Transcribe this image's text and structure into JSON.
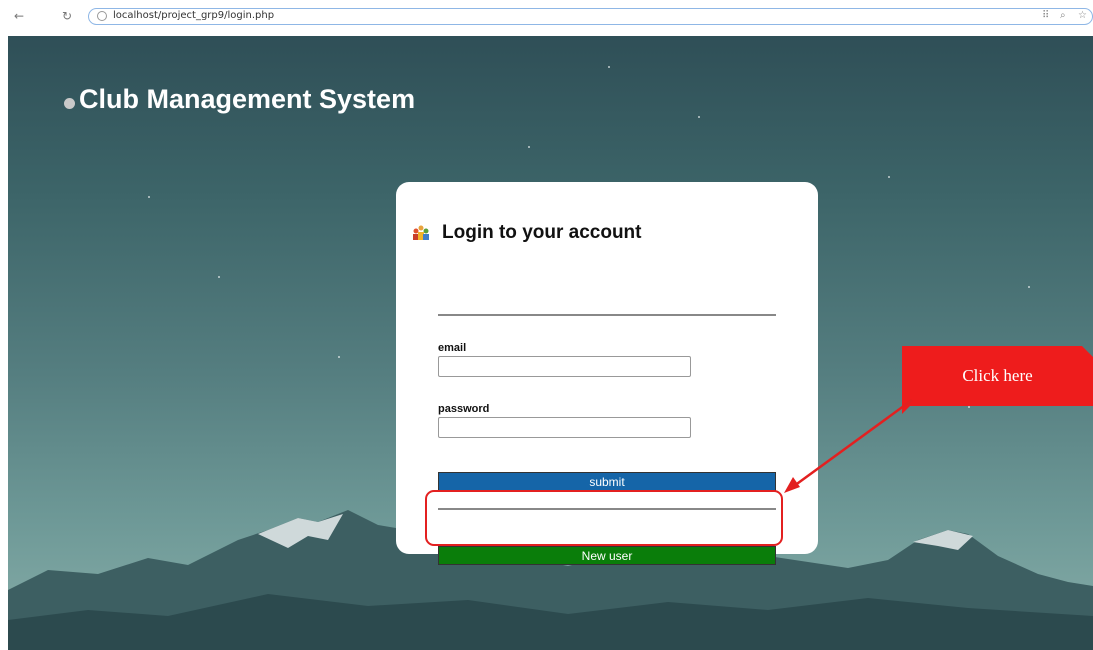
{
  "browser": {
    "url": "localhost/project_grp9/login.php",
    "back_icon": "arrow-left-icon",
    "reload_icon": "reload-icon",
    "right_icons": [
      "grid-icon",
      "zoom-icon",
      "star-icon"
    ]
  },
  "page": {
    "site_title": "Club Management System"
  },
  "login_card": {
    "title": "Login to your account",
    "icon": "people-group-icon",
    "email_label": "email",
    "email_value": "",
    "password_label": "password",
    "password_value": "",
    "submit_label": "submit",
    "new_user_label": "New user"
  },
  "annotation": {
    "callout_text": "Click here",
    "color": "#e32020"
  },
  "colors": {
    "submit_button": "#1565a8",
    "new_user_button": "#0a7d0a"
  }
}
